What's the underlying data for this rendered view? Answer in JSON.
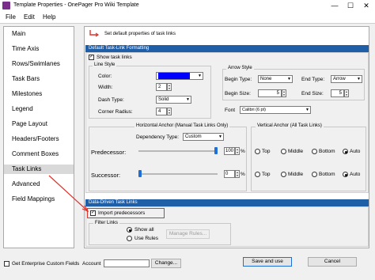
{
  "window": {
    "title": "Template Properties - OnePager Pro Wiki Template",
    "minimize_glyph": "—",
    "maximize_glyph": "☐",
    "close_glyph": "✕"
  },
  "menu": {
    "file": "File",
    "edit": "Edit",
    "help": "Help"
  },
  "sidebar": {
    "items": [
      {
        "label": "Main"
      },
      {
        "label": "Time Axis"
      },
      {
        "label": "Rows/Swimlanes"
      },
      {
        "label": "Task Bars"
      },
      {
        "label": "Milestones"
      },
      {
        "label": "Legend"
      },
      {
        "label": "Page Layout"
      },
      {
        "label": "Headers/Footers"
      },
      {
        "label": "Comment Boxes"
      },
      {
        "label": "Task Links",
        "selected": true
      },
      {
        "label": "Advanced"
      },
      {
        "label": "Field Mappings"
      }
    ]
  },
  "content": {
    "hint": "Set default properties of task links",
    "default_section": {
      "header": "Default Task-Link Formatting",
      "show_task_links": "Show task links",
      "line_style": {
        "title": "Line Style",
        "color_label": "Color:",
        "color_value": "#0000ff",
        "width_label": "Width:",
        "width_value": "2",
        "dash_label": "Dash Type:",
        "dash_value": "Solid",
        "radius_label": "Corner Radius:",
        "radius_value": "4"
      },
      "arrow_style": {
        "title": "Arrow Style",
        "begin_type_label": "Begin Type:",
        "begin_type_value": "None",
        "end_type_label": "End Type:",
        "end_type_value": "Arrow",
        "begin_size_label": "Begin Size:",
        "begin_size_value": "5",
        "end_size_label": "End Size:",
        "end_size_value": "5"
      },
      "font_label": "Font",
      "font_value": "Calibri (6 pt)",
      "horizontal_anchor": {
        "title": "Horizontal Anchor (Manual Task Links Only)",
        "dependency_label": "Dependency Type:",
        "dependency_value": "Custom",
        "predecessor_label": "Predecessor:",
        "predecessor_value": "100",
        "predecessor_fraction": 1.0,
        "successor_label": "Successor:",
        "successor_value": "0",
        "successor_fraction": 0.0,
        "percent": "%"
      },
      "vertical_anchor": {
        "title": "Vertical Anchor (All Task Links)",
        "options": [
          "Top",
          "Middle",
          "Bottom",
          "Auto"
        ],
        "pred_selected": "Auto",
        "succ_selected": "Auto"
      }
    },
    "data_driven": {
      "header": "Data-Driven Task Links",
      "import_predecessors": "Import predecessors",
      "filter_title": "Filter Links",
      "show_all": "Show all",
      "use_rules": "Use Rules",
      "manage_rules": "Manage Rules..."
    }
  },
  "footer": {
    "enterprise_checkbox": "Get Enterprise Custom Fields",
    "account_label": "Account",
    "account_value": "",
    "change_button": "Change...",
    "save_button": "Save and use",
    "cancel_button": "Cancel"
  },
  "colors": {
    "section_header": "#1f5fa8",
    "annotation_red": "#e0332a",
    "selected_item": "#d9d9d9"
  }
}
